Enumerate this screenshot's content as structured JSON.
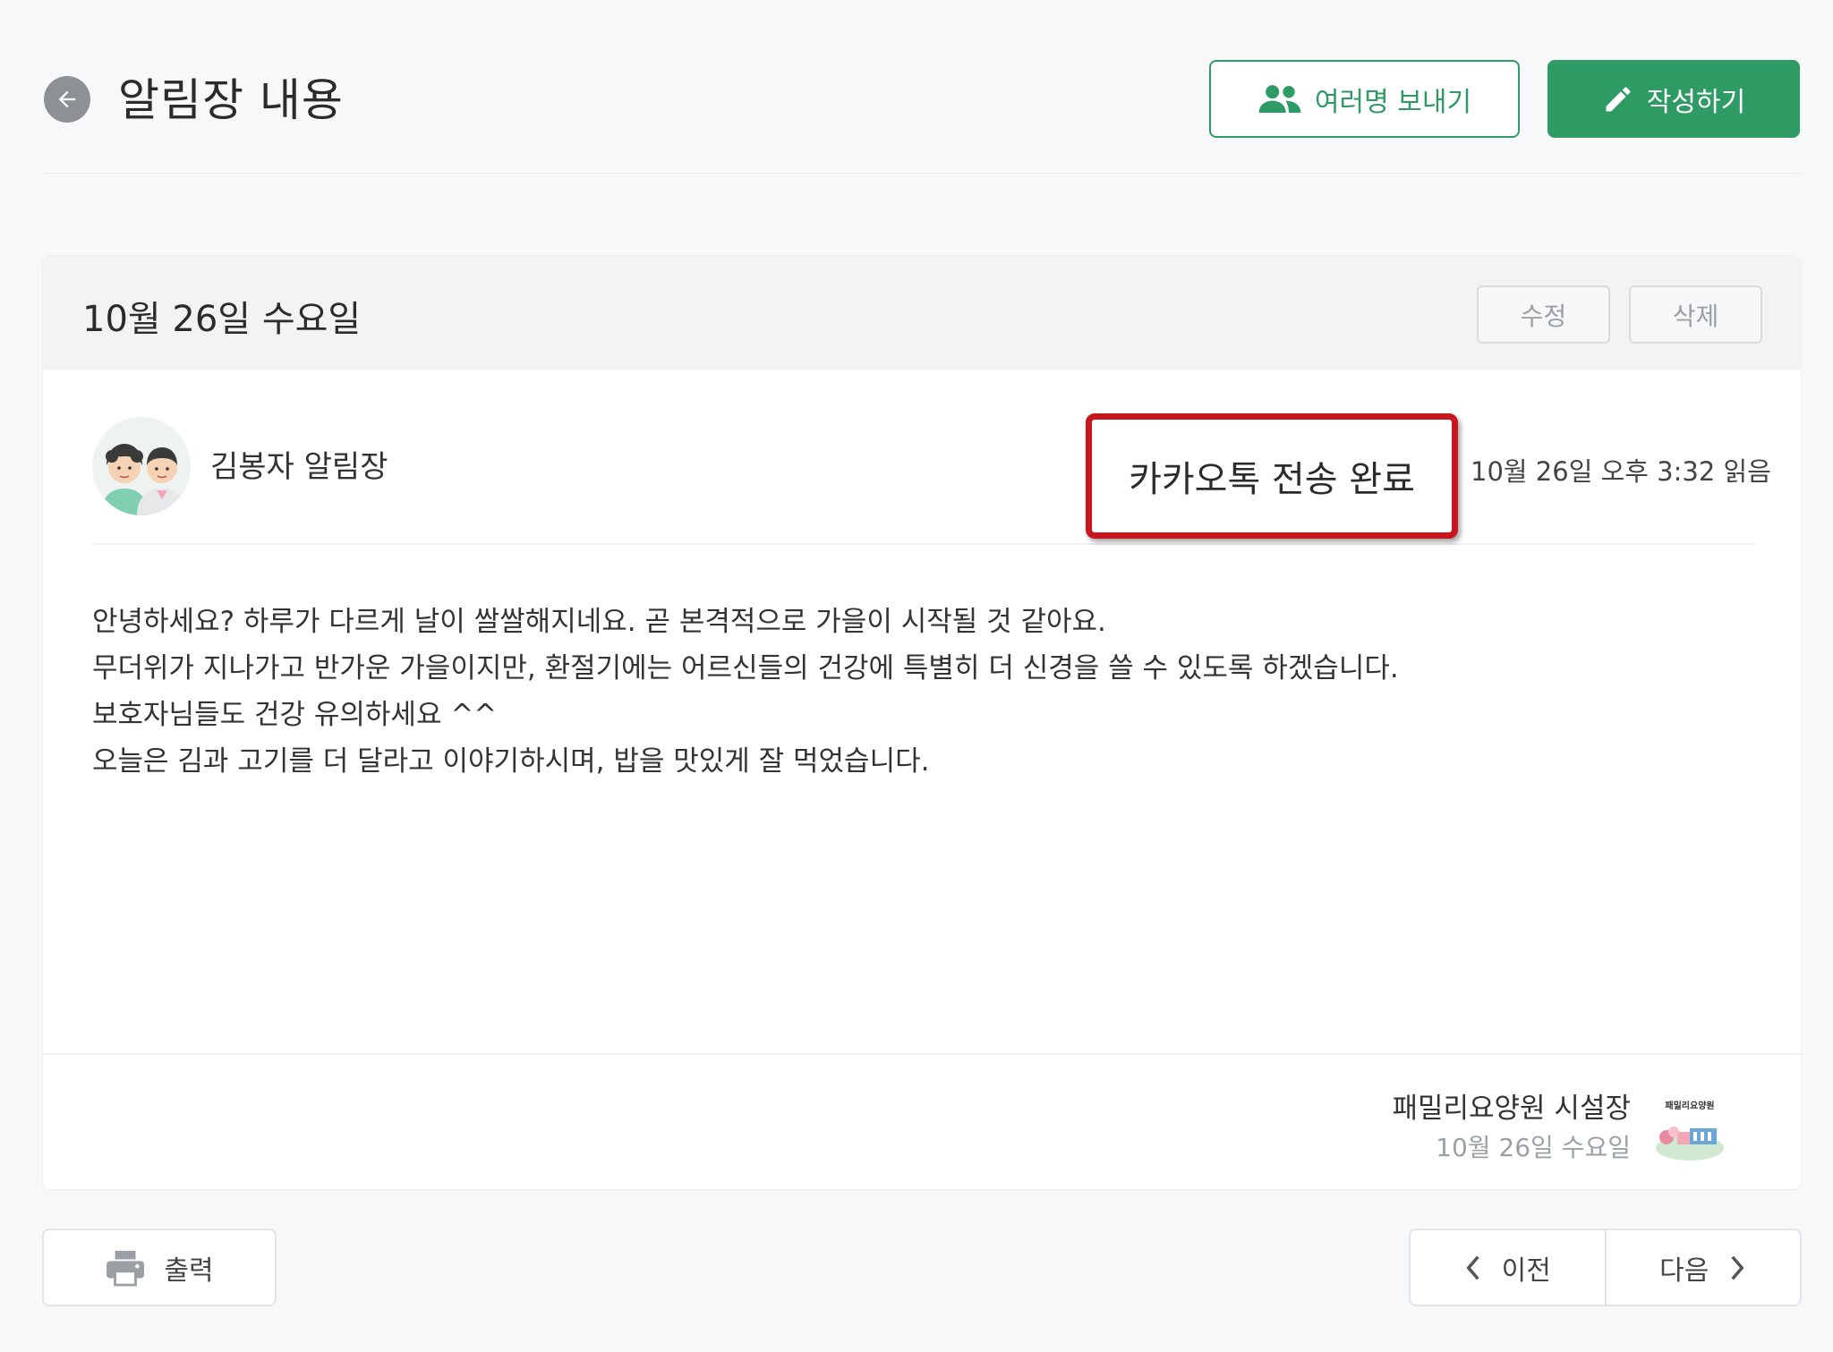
{
  "header": {
    "title": "알림장 내용",
    "multi_send_label": "여러명 보내기",
    "write_label": "작성하기"
  },
  "card": {
    "date": "10월 26일 수요일",
    "edit_label": "수정",
    "delete_label": "삭제",
    "sender": "김봉자 알림장",
    "kakao_status": "카카오톡 전송 완료",
    "read_status": "10월 26일 오후 3:32 읽음",
    "message_lines": [
      "안녕하세요? 하루가 다르게 날이 쌀쌀해지네요. 곧 본격적으로 가을이 시작될 것 같아요.",
      "무더위가 지나가고 반가운 가을이지만, 환절기에는 어르신들의 건강에 특별히 더 신경을 쓸 수 있도록 하겠습니다.",
      "보호자님들도 건강 유의하세요 ^^",
      "",
      "오늘은 김과 고기를 더 달라고 이야기하시며, 밥을 맛있게 잘 먹었습니다."
    ],
    "footer": {
      "author": "패밀리요양원 시설장",
      "date": "10월 26일 수요일",
      "logo_text": "패밀리요양원"
    }
  },
  "bottom": {
    "print_label": "출력",
    "prev_label": "이전",
    "next_label": "다음"
  },
  "colors": {
    "accent": "#2e9a64",
    "highlight": "#c8161e"
  }
}
